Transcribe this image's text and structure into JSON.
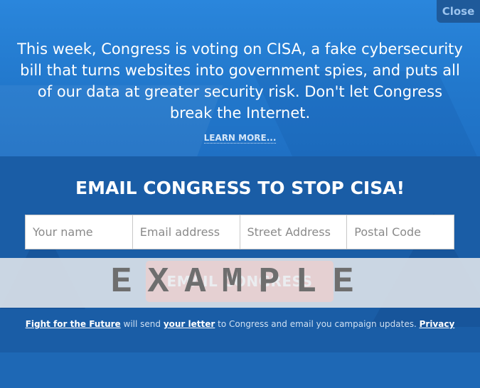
{
  "close_label": "Close",
  "headline": "This week, Congress is voting on CISA, a fake cybersecurity bill that turns websites into government spies, and puts all of our data at greater security risk. Don't let Congress break the Internet.",
  "learn_more": "LEARN MORE...",
  "form": {
    "title": "EMAIL CONGRESS TO STOP CISA!",
    "fields": [
      {
        "placeholder": "Your name",
        "value": ""
      },
      {
        "placeholder": "Email address",
        "value": ""
      },
      {
        "placeholder": "Street Address",
        "value": ""
      },
      {
        "placeholder": "Postal Code",
        "value": ""
      }
    ],
    "submit_label": "EMAIL CONGRESS"
  },
  "watermark": "EXAMPLE",
  "disclaimer": {
    "org_link": "Fight for the Future",
    "text1": " will send ",
    "letter_link": "your letter",
    "text2": " to Congress and email you campaign updates. ",
    "privacy_link": "Privacy"
  },
  "colors": {
    "top_background": "#2a86dc",
    "bottom_background": "#1a5da6",
    "submit_button": "#d6322f",
    "close_button": "#1f5a9a"
  }
}
